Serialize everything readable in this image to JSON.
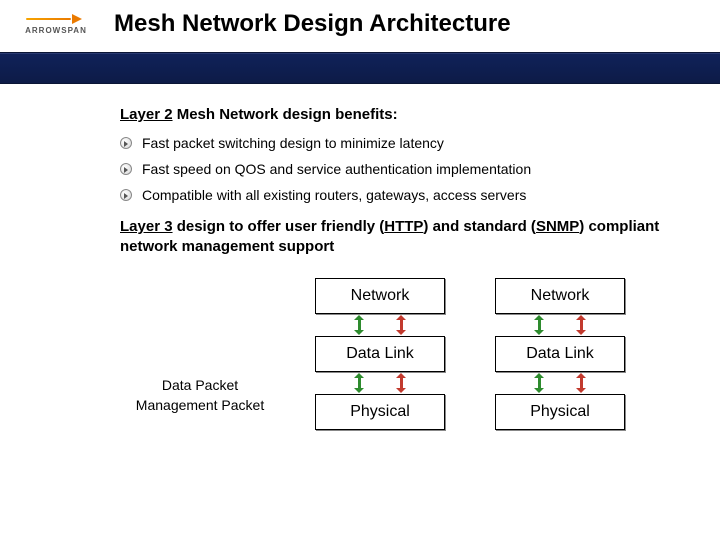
{
  "logo_text": "ARROWSPAN",
  "title": "Mesh Network Design Architecture",
  "section1": {
    "prefix": "Layer 2",
    "suffix": " Mesh Network design benefits:"
  },
  "bullets": [
    "Fast packet switching design to minimize latency",
    "Fast speed on QOS and service authentication implementation",
    "Compatible with all existing routers, gateways, access servers"
  ],
  "section2": {
    "p1a": "Layer 3",
    "p1b": " design to offer user friendly (",
    "p1c": "HTTP",
    "p1d": ") and standard (",
    "p1e": "SNMP",
    "p1f": ") compliant network management support"
  },
  "side": {
    "l1": "Data Packet",
    "l2": "Management Packet"
  },
  "stack": {
    "network": "Network",
    "datalink": "Data Link",
    "physical": "Physical"
  }
}
